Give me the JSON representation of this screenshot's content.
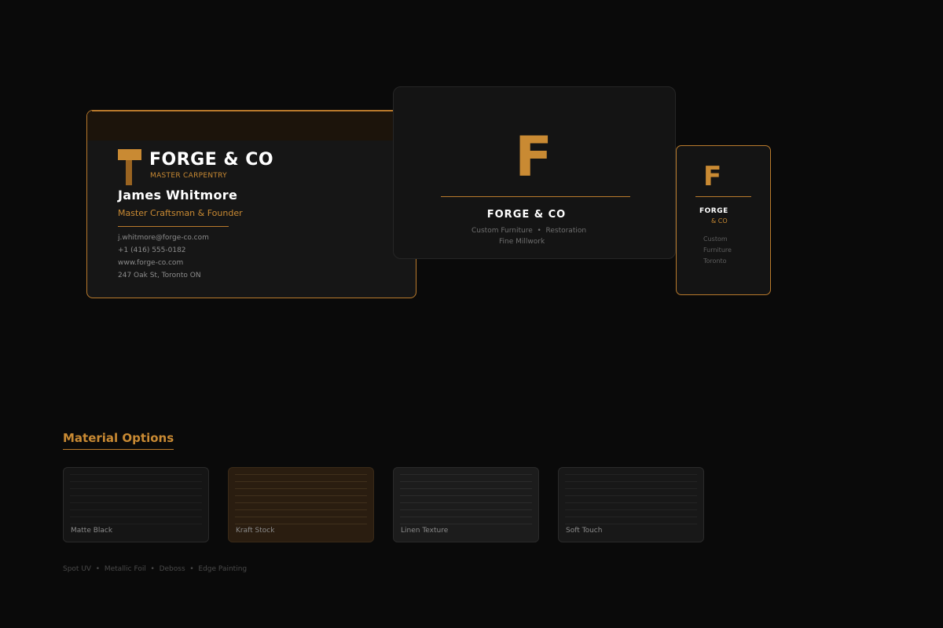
{
  "front_card": {
    "brand": "FORGE & CO",
    "tagline": "MASTER CARPENTRY",
    "name": "James Whitmore",
    "role": "Master Craftsman & Founder",
    "email": "j.whitmore@forge-co.com",
    "phone": "+1 (416) 555-0182",
    "website": "www.forge-co.com",
    "address": "247 Oak St, Toronto ON",
    "logo_icon": "t-hammer-icon"
  },
  "back_card": {
    "monogram": "F",
    "brand": "FORGE & CO",
    "services_line1": "Custom Furniture  •  Restoration",
    "services_line2": "Fine Millwork"
  },
  "vertical_card": {
    "monogram": "F",
    "brand": "FORGE",
    "brand_sub": "& CO",
    "lines": [
      "Custom",
      "Furniture",
      "Toronto"
    ]
  },
  "materials": {
    "heading": "Material Options",
    "options": [
      {
        "label": "Matte Black"
      },
      {
        "label": "Kraft Stock"
      },
      {
        "label": "Linen Texture"
      },
      {
        "label": "Soft Touch"
      }
    ],
    "finishes": "Spot UV  •  Metallic Foil  •  Deboss  •  Edge Painting"
  },
  "colors": {
    "background": "#0a0a0a",
    "card": "#161616",
    "accent": "#c98a33",
    "accent_dark": "#9a6421",
    "text": "#ffffff",
    "muted": "#8c8c8c"
  }
}
